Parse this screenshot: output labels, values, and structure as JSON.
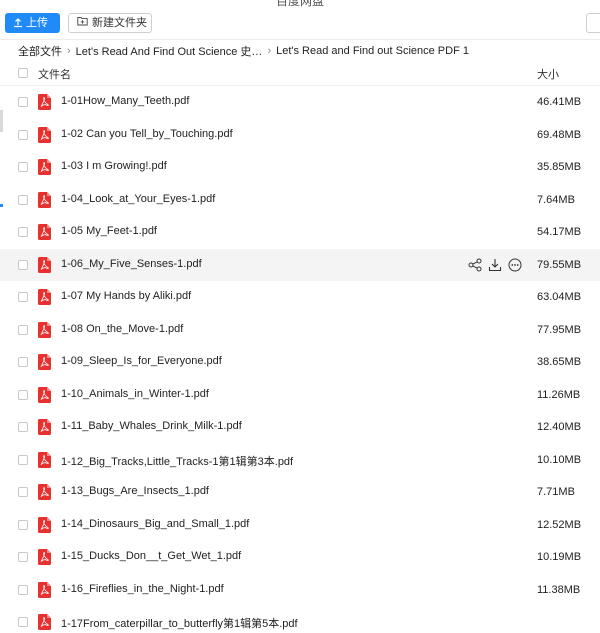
{
  "window": {
    "title": "百度网盘"
  },
  "toolbar": {
    "upload_label": "上传",
    "new_folder_label": "新建文件夹"
  },
  "breadcrumb": [
    "全部文件",
    "Let's Read And Find Out Science 史…",
    "Let's Read and Find out Science PDF 1"
  ],
  "table": {
    "header": {
      "name": "文件名",
      "size": "大小"
    },
    "rows": [
      {
        "name": "1-01How_Many_Teeth.pdf",
        "size": "46.41MB"
      },
      {
        "name": "1-02 Can you Tell_by_Touching.pdf",
        "size": "69.48MB"
      },
      {
        "name": "1-03 I m Growing!.pdf",
        "size": "35.85MB"
      },
      {
        "name": "1-04_Look_at_Your_Eyes-1.pdf",
        "size": "7.64MB"
      },
      {
        "name": "1-05 My_Feet-1.pdf",
        "size": "54.17MB"
      },
      {
        "name": "1-06_My_Five_Senses-1.pdf",
        "size": "79.55MB"
      },
      {
        "name": "1-07 My Hands by Aliki.pdf",
        "size": "63.04MB"
      },
      {
        "name": "1-08 On_the_Move-1.pdf",
        "size": "77.95MB"
      },
      {
        "name": "1-09_Sleep_Is_for_Everyone.pdf",
        "size": "38.65MB"
      },
      {
        "name": "1-10_Animals_in_Winter-1.pdf",
        "size": "11.26MB"
      },
      {
        "name": "1-11_Baby_Whales_Drink_Milk-1.pdf",
        "size": "12.40MB"
      },
      {
        "name": "1-12_Big_Tracks,Little_Tracks-1第1辑第3本.pdf",
        "size": "10.10MB"
      },
      {
        "name": "1-13_Bugs_Are_Insects_1.pdf",
        "size": "7.71MB"
      },
      {
        "name": "1-14_Dinosaurs_Big_and_Small_1.pdf",
        "size": "12.52MB"
      },
      {
        "name": "1-15_Ducks_Don__t_Get_Wet_1.pdf",
        "size": "10.19MB"
      },
      {
        "name": "1-16_Fireflies_in_the_Night-1.pdf",
        "size": "11.38MB"
      },
      {
        "name": "1-17From_caterpillar_to_butterfly第1辑第5本.pdf",
        "size": ""
      }
    ],
    "hovered_row_index": 5,
    "row_actions": [
      "share-icon",
      "download-icon",
      "more-icon"
    ]
  },
  "colors": {
    "accent": "#1f8af8",
    "pdf_red": "#e8312f",
    "hover_bg": "#f4f4f4"
  }
}
